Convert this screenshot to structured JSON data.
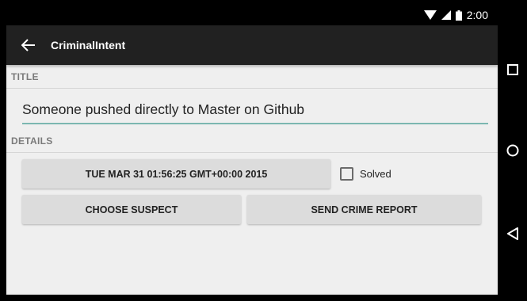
{
  "status_bar": {
    "time": "2:00"
  },
  "app_bar": {
    "title": "CriminalIntent"
  },
  "sections": {
    "title_header": "TITLE",
    "details_header": "DETAILS"
  },
  "crime": {
    "title_value": "Someone pushed directly to Master on Github",
    "date_label": "TUE MAR 31 01:56:25 GMT+00:00 2015",
    "solved_label": "Solved",
    "solved": false
  },
  "buttons": {
    "choose_suspect": "CHOOSE SUSPECT",
    "send_report": "SEND CRIME REPORT"
  },
  "colors": {
    "app_bar": "#212121",
    "background": "#efefef",
    "accent": "#7bb7b1",
    "button": "#dcdcdc"
  },
  "icons": [
    "wifi-icon",
    "signal-icon",
    "battery-icon",
    "back-arrow-icon",
    "recents-icon",
    "home-icon",
    "back-nav-icon"
  ]
}
